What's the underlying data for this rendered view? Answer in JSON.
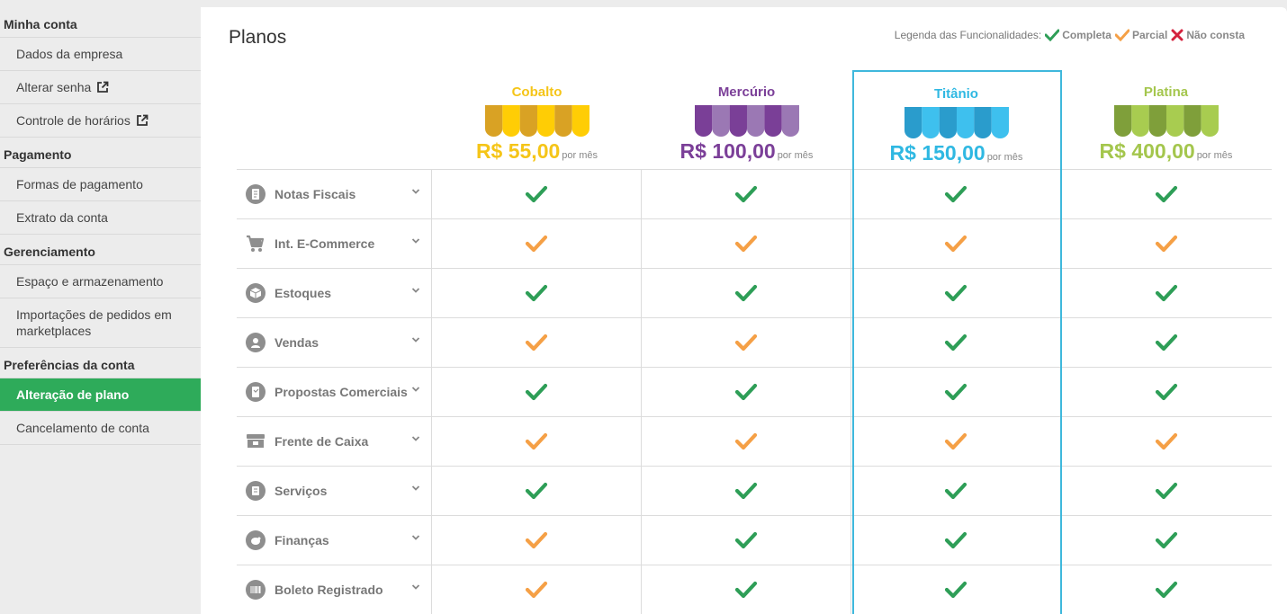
{
  "sidebar": {
    "sections": [
      {
        "title": "Minha conta",
        "items": [
          {
            "label": "Dados da empresa",
            "ext": false
          },
          {
            "label": "Alterar senha",
            "ext": true
          },
          {
            "label": "Controle de horários",
            "ext": true
          }
        ]
      },
      {
        "title": "Pagamento",
        "items": [
          {
            "label": "Formas de pagamento",
            "ext": false
          },
          {
            "label": "Extrato da conta",
            "ext": false
          }
        ]
      },
      {
        "title": "Gerenciamento",
        "items": [
          {
            "label": "Espaço e armazenamento",
            "ext": false
          },
          {
            "label": "Importações de pedidos em marketplaces",
            "ext": false
          }
        ]
      },
      {
        "title": "Preferências da conta",
        "items": [
          {
            "label": "Alteração de plano",
            "ext": false,
            "active": true
          },
          {
            "label": "Cancelamento de conta",
            "ext": false
          }
        ]
      }
    ]
  },
  "main": {
    "title": "Planos",
    "legend": {
      "prefix": "Legenda das Funcionalidades:",
      "complete": "Completa",
      "partial": "Parcial",
      "none": "Não consta"
    }
  },
  "colors": {
    "complete": "#2e9e57",
    "partial": "#f5a046",
    "none": "#d4213d",
    "active_sidebar": "#2eab5a",
    "highlight_border": "#3fb8dc"
  },
  "plans": [
    {
      "name": "Cobalto",
      "price": "R$ 55,00",
      "period": "por mês",
      "color": "#f5c518",
      "awning": [
        "#d9a224",
        "#ffcd05"
      ]
    },
    {
      "name": "Mercúrio",
      "price": "R$ 100,00",
      "period": "por mês",
      "color": "#7b3f98",
      "awning": [
        "#7a3f97",
        "#9b78b4"
      ]
    },
    {
      "name": "Titânio",
      "price": "R$ 150,00",
      "period": "por mês",
      "color": "#2fb8e2",
      "awning": [
        "#2a9ccc",
        "#3ec0ee"
      ],
      "highlighted": true
    },
    {
      "name": "Platina",
      "price": "R$ 400,00",
      "period": "por mês",
      "color": "#a4c64d",
      "awning": [
        "#7f9f3a",
        "#a8cc50"
      ]
    }
  ],
  "features": [
    {
      "label": "Notas Fiscais",
      "icon": "invoice-icon",
      "values": [
        "complete",
        "complete",
        "complete",
        "complete"
      ]
    },
    {
      "label": "Int. E-Commerce",
      "icon": "cart-icon",
      "values": [
        "partial",
        "partial",
        "partial",
        "partial"
      ]
    },
    {
      "label": "Estoques",
      "icon": "box-icon",
      "values": [
        "complete",
        "complete",
        "complete",
        "complete"
      ]
    },
    {
      "label": "Vendas",
      "icon": "sales-icon",
      "values": [
        "partial",
        "partial",
        "complete",
        "complete"
      ]
    },
    {
      "label": "Propostas Comerciais",
      "icon": "proposal-icon",
      "values": [
        "complete",
        "complete",
        "complete",
        "complete"
      ]
    },
    {
      "label": "Frente de Caixa",
      "icon": "store-icon",
      "values": [
        "partial",
        "partial",
        "partial",
        "partial"
      ]
    },
    {
      "label": "Serviços",
      "icon": "services-icon",
      "values": [
        "complete",
        "complete",
        "complete",
        "complete"
      ]
    },
    {
      "label": "Finanças",
      "icon": "piggy-bank-icon",
      "values": [
        "partial",
        "complete",
        "complete",
        "complete"
      ]
    },
    {
      "label": "Boleto Registrado",
      "icon": "barcode-icon",
      "values": [
        "partial",
        "complete",
        "complete",
        "complete"
      ]
    }
  ]
}
